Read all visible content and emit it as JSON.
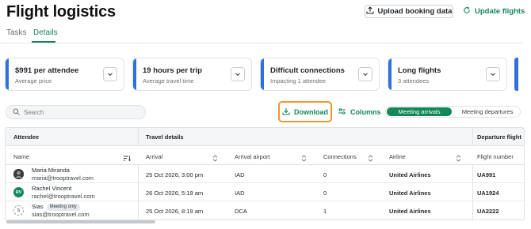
{
  "header": {
    "title": "Flight logistics",
    "upload_label": "Upload booking data",
    "update_label": "Update flights"
  },
  "tabs": [
    {
      "label": "Tasks",
      "active": false
    },
    {
      "label": "Details",
      "active": true
    }
  ],
  "summary_cards": [
    {
      "title": "$991 per attendee",
      "subtitle": "Average price"
    },
    {
      "title": "19 hours per trip",
      "subtitle": "Average travel time"
    },
    {
      "title": "Difficult connections",
      "subtitle": "Impacting 1 attendee"
    },
    {
      "title": "Long flights",
      "subtitle": "3 attendees"
    }
  ],
  "toolbar": {
    "search_placeholder": "Search",
    "download_label": "Download",
    "columns_label": "Columns",
    "toggle_options": [
      "Meeting arrivals",
      "Meeting departures"
    ],
    "toggle_selected": "Meeting arrivals"
  },
  "table": {
    "groups": [
      "Attendee",
      "Travel details",
      "Departure flight"
    ],
    "columns": [
      "Name",
      "Arrival",
      "Arrival airport",
      "Connections",
      "Airline",
      "Flight number"
    ],
    "rows": [
      {
        "name": "Maria Miranda",
        "email": "maria@trooptravel.com",
        "initials": "",
        "badge": "",
        "arrival": "25 Oct 2026, 3:00 pm",
        "airport": "IAD",
        "connections": "0",
        "airline": "United Airlines",
        "flight": "UA991"
      },
      {
        "name": "Rachel Vincent",
        "email": "rachel@trooptravel.com",
        "initials": "RV",
        "badge": "",
        "arrival": "26 Oct 2026, 5:19 am",
        "airport": "IAD",
        "connections": "0",
        "airline": "United Airlines",
        "flight": "UA1924"
      },
      {
        "name": "Sias",
        "email": "sias@trooptravel.com",
        "initials": "S",
        "badge": "Meeting only",
        "arrival": "25 Oct 2026, 8:19 am",
        "airport": "DCA",
        "connections": "1",
        "airline": "United Airlines",
        "flight": "UA2222"
      }
    ]
  },
  "colors": {
    "brand_green": "#14875a",
    "card_accent_blue": "#2f6fde",
    "focus_orange": "#f0962e"
  }
}
